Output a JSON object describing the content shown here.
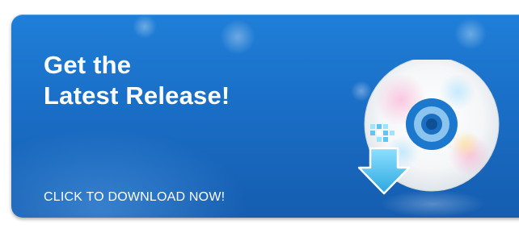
{
  "banner": {
    "headline_line1": "Get the",
    "headline_line2": "Latest Release!",
    "cta_label": "CLICK TO DOWNLOAD NOW!",
    "icons": [
      "cd-disc-icon",
      "download-arrow-icon"
    ],
    "colors": {
      "background_top": "#1f7fd8",
      "background_bottom": "#155db0",
      "text": "#ffffff",
      "arrow": "#5ec6f0"
    }
  }
}
